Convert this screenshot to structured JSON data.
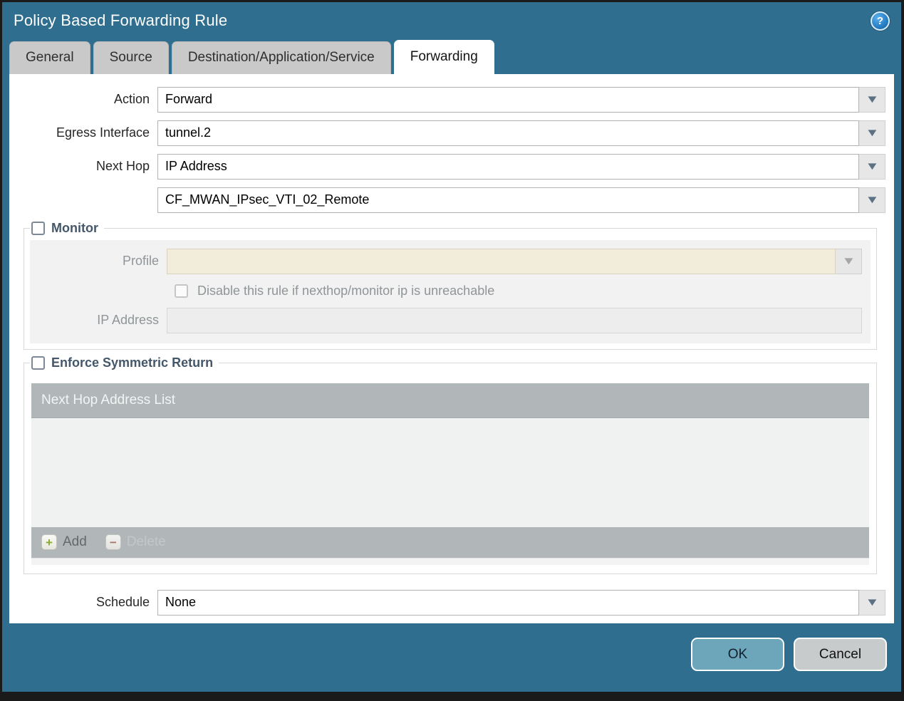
{
  "colors": {
    "frame_teal": "#2f6e8e",
    "active_tab_bg": "#ffffff",
    "inactive_tab_bg": "#c9c9c9",
    "panel_gray": "#f2f2f2",
    "disabled_beige": "#f2edda",
    "grid_bar_gray": "#b1b6b9",
    "ok_button_bg": "#6da6ba",
    "cancel_button_bg": "#c8cbcc",
    "legend_text": "#44576a"
  },
  "icons": {
    "help": "?",
    "dropdown_arrow": "▼",
    "add": "+",
    "delete": "−"
  },
  "window": {
    "title": "Policy Based Forwarding Rule"
  },
  "tabs": [
    {
      "label": "General",
      "active": false
    },
    {
      "label": "Source",
      "active": false
    },
    {
      "label": "Destination/Application/Service",
      "active": false
    },
    {
      "label": "Forwarding",
      "active": true
    }
  ],
  "form": {
    "action": {
      "label": "Action",
      "value": "Forward"
    },
    "egress_interface": {
      "label": "Egress Interface",
      "value": "tunnel.2"
    },
    "next_hop": {
      "label": "Next Hop",
      "value": "IP Address"
    },
    "next_hop_address": {
      "label": "",
      "value": "CF_MWAN_IPsec_VTI_02_Remote"
    },
    "schedule": {
      "label": "Schedule",
      "value": "None"
    }
  },
  "monitor": {
    "legend": "Monitor",
    "checked": false,
    "profile": {
      "label": "Profile",
      "value": ""
    },
    "disable_rule_checkbox": {
      "label": "Disable this rule if nexthop/monitor ip is unreachable",
      "checked": false
    },
    "ip_address": {
      "label": "IP Address",
      "value": ""
    }
  },
  "symmetric_return": {
    "legend": "Enforce Symmetric Return",
    "checked": false,
    "table": {
      "header": "Next Hop Address List",
      "rows": [],
      "add_label": "Add",
      "delete_label": "Delete"
    }
  },
  "footer": {
    "ok_label": "OK",
    "cancel_label": "Cancel"
  }
}
